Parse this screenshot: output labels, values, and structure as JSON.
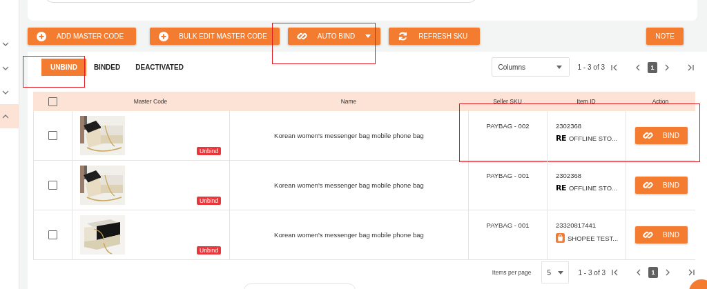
{
  "sidebar": {
    "items": [
      {
        "expanded": false
      },
      {
        "expanded": false
      },
      {
        "expanded": false
      },
      {
        "expanded": true
      }
    ]
  },
  "toolbar": {
    "buttons": [
      {
        "label": "ADD MASTER CODE",
        "dropdown": false,
        "highlighted": false
      },
      {
        "label": "BULK EDIT MASTER CODE",
        "dropdown": false,
        "highlighted": false
      },
      {
        "label": "AUTO BIND",
        "dropdown": true,
        "highlighted": true
      },
      {
        "label": "REFRESH SKU",
        "dropdown": false,
        "highlighted": false
      }
    ],
    "note_button": "NOTE"
  },
  "tabs": [
    {
      "label": "UNBIND",
      "selected": true,
      "highlighted": true
    },
    {
      "label": "BINDED",
      "selected": false,
      "highlighted": false
    },
    {
      "label": "DEACTIVATED",
      "selected": false,
      "highlighted": false
    }
  ],
  "columns_select": {
    "value": "Columns"
  },
  "pager_top": {
    "range": "1 - 3 of 3",
    "page": "1"
  },
  "table": {
    "select_all_checked": false,
    "columns": [
      "Master Code",
      "Name",
      "Seller SKU",
      "Item ID",
      "Action"
    ],
    "rows": [
      {
        "checked": false,
        "status": "Unbind",
        "name": "Korean women's messenger bag mobile phone bag",
        "seller_sku": "PAYBAG - 002",
        "item_id": "2302368",
        "store_logo": "RE",
        "store": "OFFLINE STO...",
        "action": "BIND",
        "highlighted": true
      },
      {
        "checked": false,
        "status": "Unbind",
        "name": "Korean women's messenger bag mobile phone bag",
        "seller_sku": "PAYBAG - 001",
        "item_id": "2302368",
        "store_logo": "RE",
        "store": "OFFLINE STO...",
        "action": "BIND",
        "highlighted": false
      },
      {
        "checked": false,
        "status": "Unbind",
        "name": "Korean women's messenger bag mobile phone bag",
        "seller_sku": "PAYBAG - 001",
        "item_id": "23320817441",
        "store": "SHOPEE TEST...",
        "action": "BIND",
        "highlighted": false
      }
    ]
  },
  "pager_bottom": {
    "items_per_page_label": "Items per page",
    "items_per_page": "5",
    "range": "1 - 3 of 3",
    "page": "1"
  }
}
